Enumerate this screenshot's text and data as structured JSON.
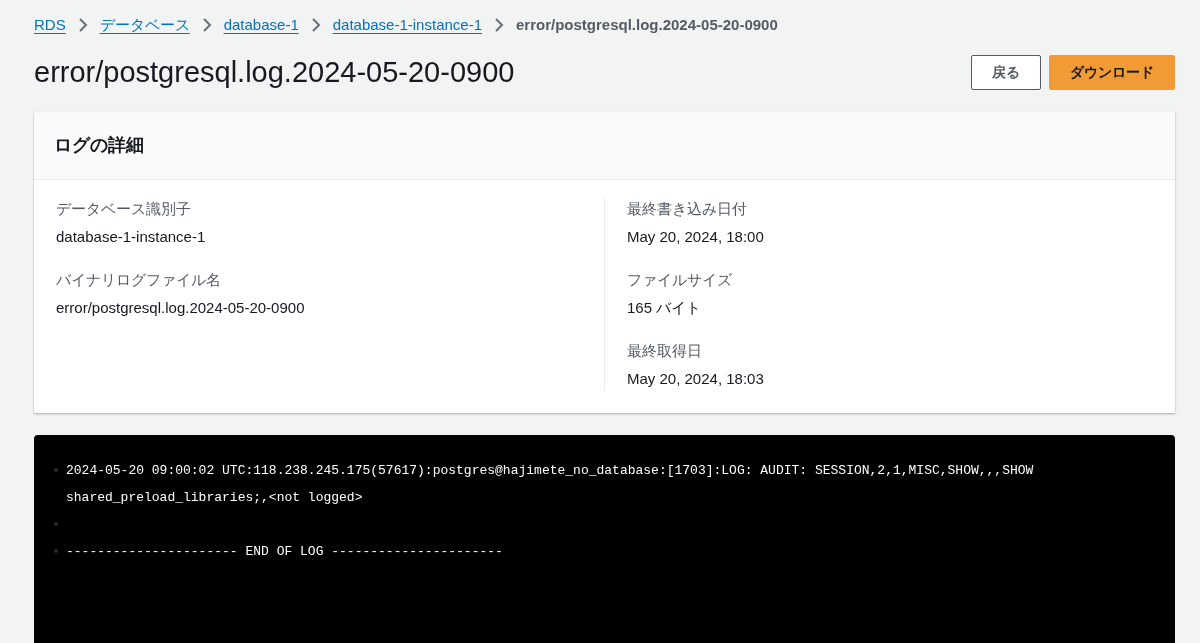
{
  "breadcrumb": [
    {
      "label": "RDS",
      "link": true
    },
    {
      "label": "データベース",
      "link": true
    },
    {
      "label": "database-1",
      "link": true
    },
    {
      "label": "database-1-instance-1",
      "link": true
    },
    {
      "label": "error/postgresql.log.2024-05-20-0900",
      "link": false
    }
  ],
  "title": "error/postgresql.log.2024-05-20-0900",
  "buttons": [
    {
      "label": "戻る",
      "kind": "normal"
    },
    {
      "label": "ダウンロード",
      "kind": "primary"
    }
  ],
  "details": {
    "title": "ログの詳細",
    "columns": [
      [
        {
          "label": "データベース識別子",
          "value": "database-1-instance-1"
        },
        {
          "label": "バイナリログファイル名",
          "value": "error/postgresql.log.2024-05-20-0900"
        }
      ],
      [
        {
          "label": "最終書き込み日付",
          "value": "May 20, 2024, 18:00"
        },
        {
          "label": "ファイルサイズ",
          "value": "165 バイト"
        },
        {
          "label": "最終取得日",
          "value": "May 20, 2024, 18:03"
        }
      ]
    ]
  },
  "log_lines": [
    {
      "kind": "text",
      "text": "2024-05-20 09:00:02 UTC:118.238.245.175(57617):postgres@hajimete_no_database:[1703]:LOG: AUDIT: SESSION,2,1,MISC,SHOW,,,SHOW shared_preload_libraries;,<not logged>"
    },
    {
      "kind": "blank"
    },
    {
      "kind": "text",
      "text": "---------------------- END OF LOG ----------------------"
    }
  ]
}
